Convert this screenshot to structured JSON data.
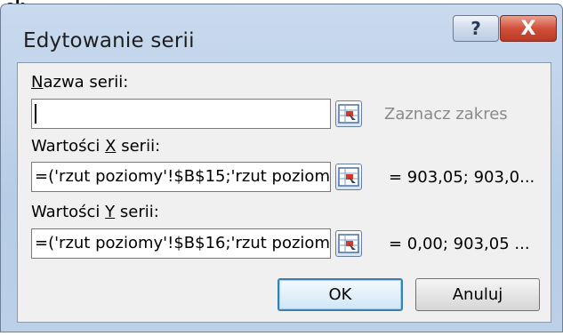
{
  "top_fragment": "ok.",
  "window": {
    "title": "Edytowanie serii",
    "help_glyph": "?",
    "close_glyph": "X"
  },
  "series_name": {
    "label_access_key": "N",
    "label_rest": "azwa serii:",
    "value": "",
    "preview_hint": "Zaznacz zakres"
  },
  "x_values": {
    "label_before": "Wartości ",
    "label_access_key": "X",
    "label_after": " serii:",
    "value": "=('rzut poziomy'!$B$15;'rzut poziom",
    "preview": "= 903,05;  903,0..."
  },
  "y_values": {
    "label_before": "Wartości ",
    "label_access_key": "Y",
    "label_after": " serii:",
    "value": "=('rzut poziomy'!$B$16;'rzut poziom",
    "preview": "= 0,00;  903,05 ..."
  },
  "buttons": {
    "ok": "OK",
    "cancel": "Anuluj"
  },
  "icons": {
    "help": "help-icon",
    "close": "close-icon",
    "range_selector": "collapse-dialog-icon"
  },
  "colors": {
    "frame": "#bcd0e8",
    "close_button": "#c9452f",
    "range_icon_red": "#d23a2a",
    "hint_text": "#8a8a8a"
  }
}
